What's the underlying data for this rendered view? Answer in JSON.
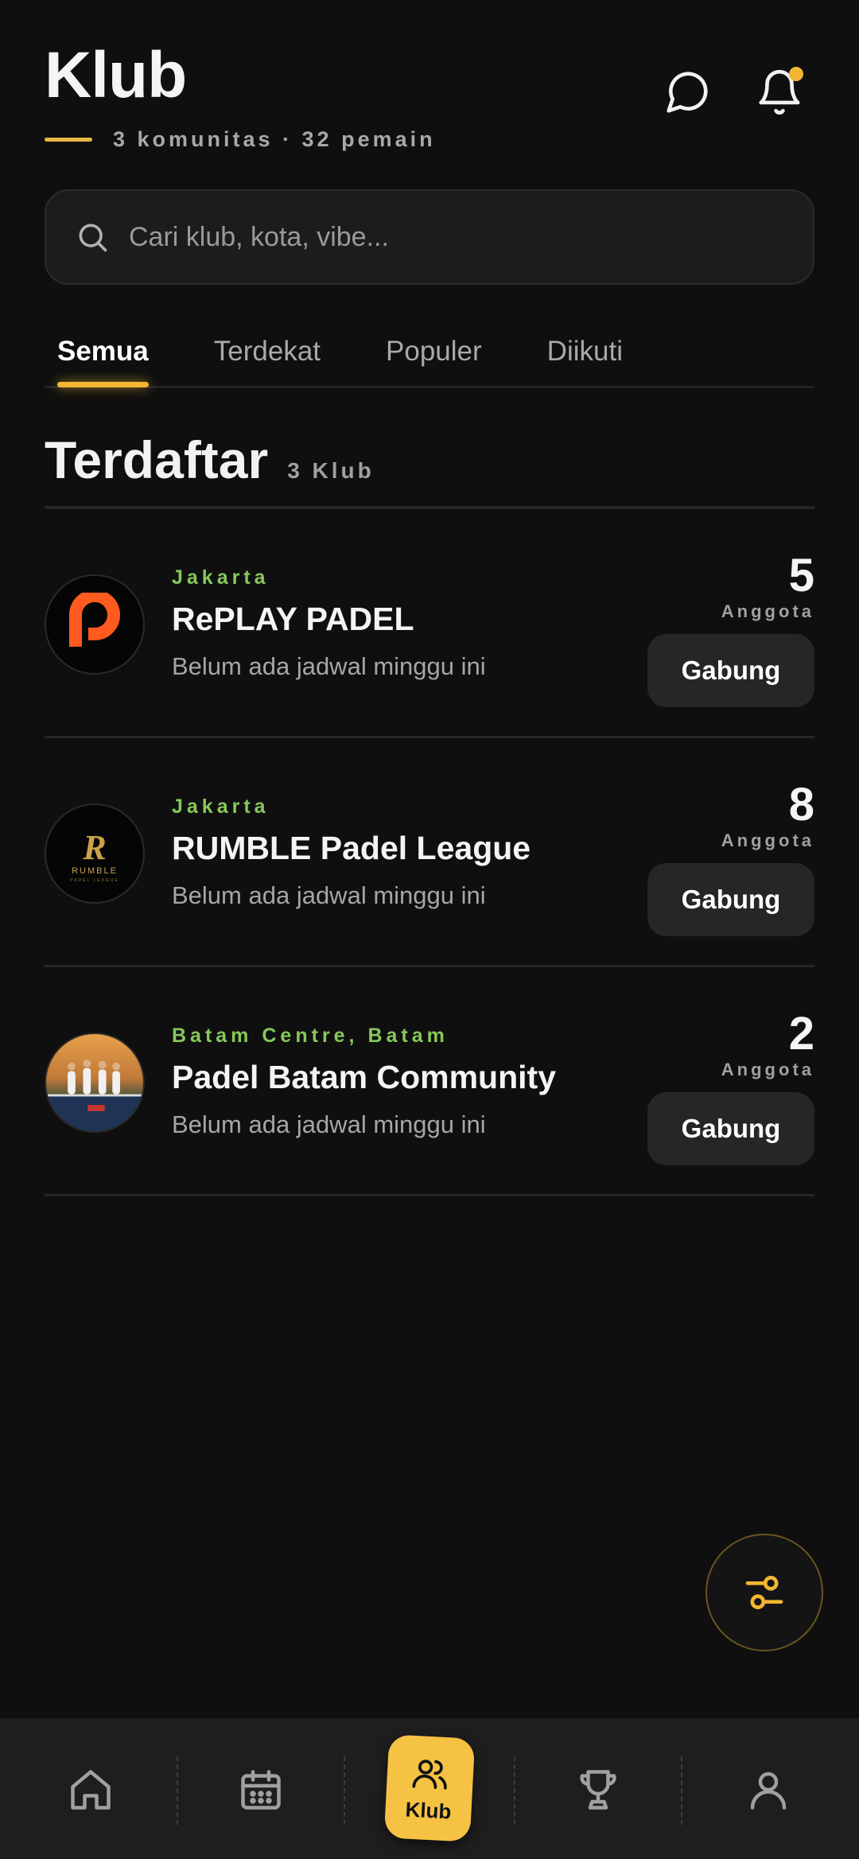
{
  "header": {
    "title": "Klub",
    "subtitle": "3 komunitas · 32 pemain"
  },
  "search": {
    "placeholder": "Cari klub, kota, vibe..."
  },
  "tabs": [
    {
      "label": "Semua"
    },
    {
      "label": "Terdekat"
    },
    {
      "label": "Populer"
    },
    {
      "label": "Diikuti"
    }
  ],
  "section": {
    "title": "Terdaftar",
    "count": "3 Klub"
  },
  "clubs": [
    {
      "city": "Jakarta",
      "name": "RePLAY PADEL",
      "schedule": "Belum ada jadwal minggu ini",
      "members": "5",
      "members_label": "Anggota",
      "join_label": "Gabung",
      "logo_text": "P"
    },
    {
      "city": "Jakarta",
      "name": "RUMBLE Padel League",
      "schedule": "Belum ada jadwal minggu ini",
      "members": "8",
      "members_label": "Anggota",
      "join_label": "Gabung",
      "logo_text": "R",
      "logo_sub": "RUMBLE",
      "logo_sub2": "PADEL LEAGUE"
    },
    {
      "city": "Batam Centre, Batam",
      "name": "Padel Batam Community",
      "schedule": "Belum ada jadwal minggu ini",
      "members": "2",
      "members_label": "Anggota",
      "join_label": "Gabung"
    }
  ],
  "bottom_nav": {
    "active_label": "Klub",
    "items": [
      "home-icon",
      "calendar-icon",
      "club-icon",
      "trophy-icon",
      "profile-icon"
    ]
  },
  "colors": {
    "accent": "#f2b632",
    "city_green": "#86c85a",
    "background": "#0f0f0f"
  }
}
